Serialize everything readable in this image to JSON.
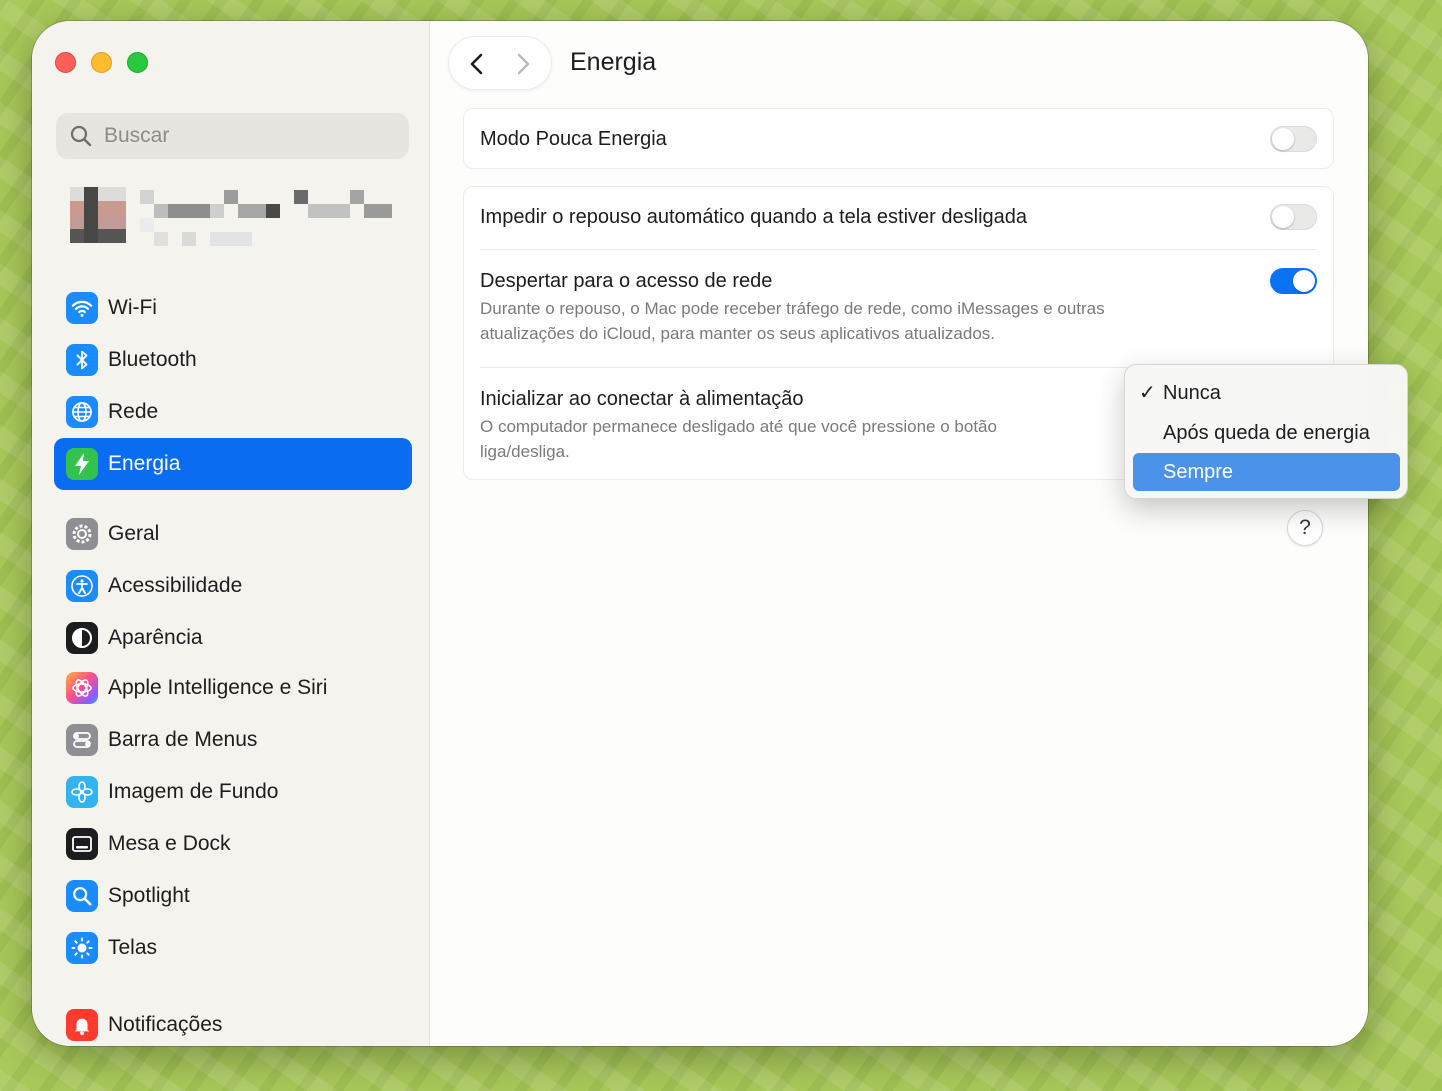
{
  "sidebar": {
    "search_placeholder": "Buscar",
    "items": [
      {
        "label": "Wi-Fi",
        "icon": "wifi-icon",
        "color": "#1a8cff"
      },
      {
        "label": "Bluetooth",
        "icon": "bluetooth-icon",
        "color": "#1a8cff"
      },
      {
        "label": "Rede",
        "icon": "globe-icon",
        "color": "#1a8cff"
      },
      {
        "label": "Energia",
        "icon": "bolt-icon",
        "color": "#33c24d"
      },
      {
        "label": "Geral",
        "icon": "gear-icon",
        "color": "#8e8e93"
      },
      {
        "label": "Acessibilidade",
        "icon": "accessibility-icon",
        "color": "#1a8cff"
      },
      {
        "label": "Aparência",
        "icon": "appearance-icon",
        "color": "#1c1c1e"
      },
      {
        "label": "Apple Intelligence e Siri",
        "icon": "siri-icon",
        "color": "#e85ab0"
      },
      {
        "label": "Barra de Menus",
        "icon": "menubar-icon",
        "color": "#8e8e93"
      },
      {
        "label": "Imagem de Fundo",
        "icon": "flower-icon",
        "color": "#32b4f0"
      },
      {
        "label": "Mesa e Dock",
        "icon": "dock-icon",
        "color": "#1c1c1e"
      },
      {
        "label": "Spotlight",
        "icon": "magnifier-icon",
        "color": "#1a8cff"
      },
      {
        "label": "Telas",
        "icon": "sun-icon",
        "color": "#1a8cff"
      },
      {
        "label": "Notificações",
        "icon": "bell-icon",
        "color": "#ff3b30"
      }
    ]
  },
  "header": {
    "title": "Energia"
  },
  "settings": {
    "low_power": {
      "title": "Modo Pouca Energia",
      "enabled": false
    },
    "prevent_sleep": {
      "title": "Impedir o repouso automático quando a tela estiver desligada",
      "enabled": false
    },
    "wake_network": {
      "title": "Despertar para o acesso de rede",
      "desc": "Durante o repouso, o Mac pode receber tráfego de rede, como iMessages e outras atualizações do iCloud, para manter os seus aplicativos atualizados.",
      "enabled": true
    },
    "start_on_power": {
      "title": "Inicializar ao conectar à alimentação",
      "desc": "O computador permanece desligado até que você pressione o botão liga/desliga."
    }
  },
  "popup_menu": {
    "options": [
      "Nunca",
      "Após queda de energia",
      "Sempre"
    ],
    "checked": "Nunca",
    "highlighted": "Sempre",
    "check_mark": "✓"
  },
  "help_label": "?",
  "colors": {
    "accent": "#0a6cf0",
    "menu_highlight": "#4b92ea"
  }
}
